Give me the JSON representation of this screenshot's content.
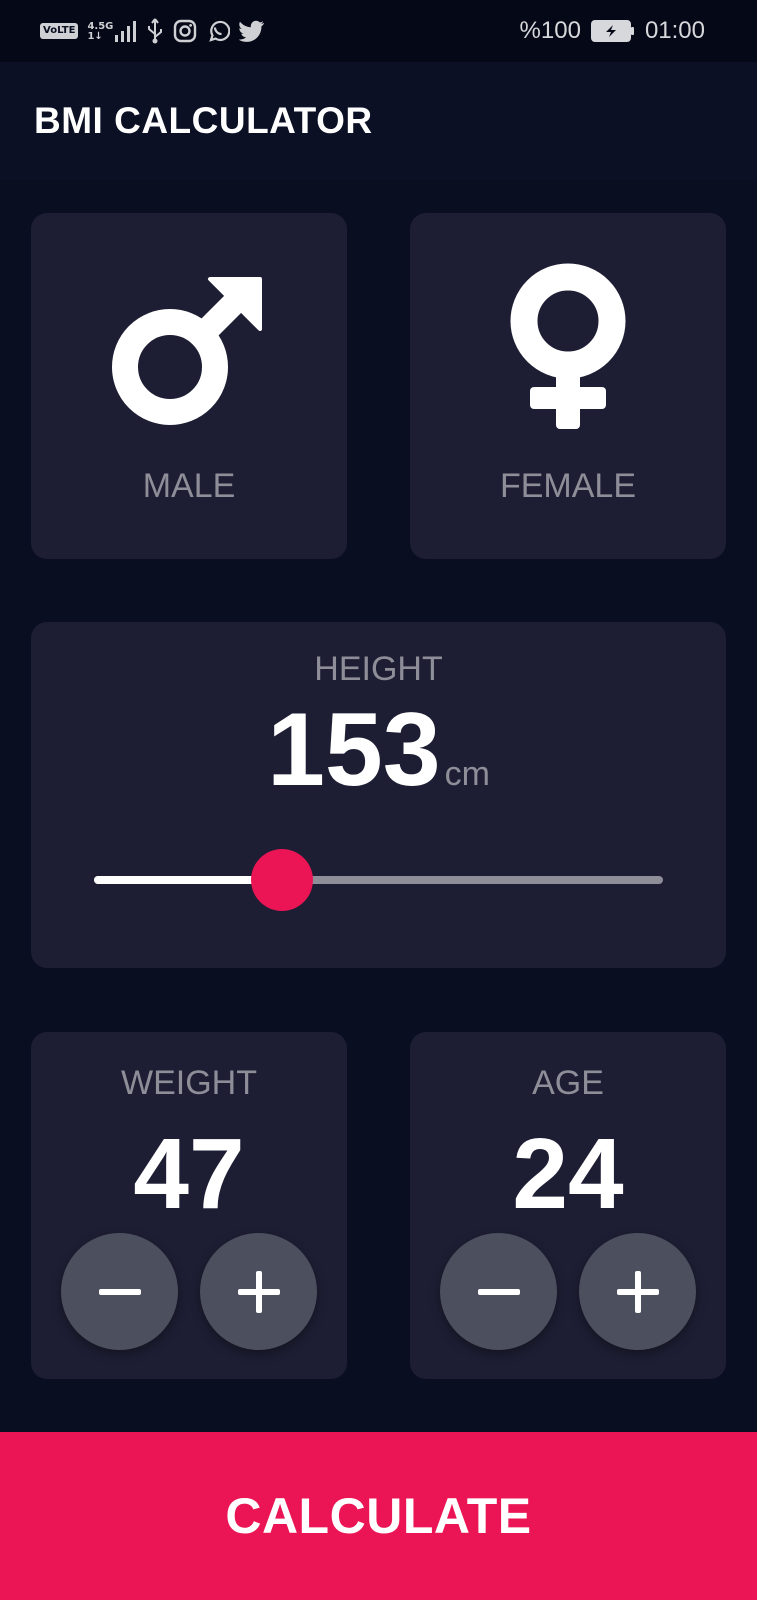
{
  "status_bar": {
    "volte": "VoLTE",
    "network": "4.5G",
    "network_sub": "1↓",
    "battery": "%100",
    "time": "01:00"
  },
  "app_bar": {
    "title": "BMI CALCULATOR"
  },
  "gender": {
    "male_label": "MALE",
    "female_label": "FEMALE"
  },
  "height": {
    "label": "HEIGHT",
    "value": "153",
    "unit": "cm",
    "slider_fraction": 0.33
  },
  "weight": {
    "label": "WEIGHT",
    "value": "47"
  },
  "age": {
    "label": "AGE",
    "value": "24"
  },
  "calculate": {
    "label": "CALCULATE"
  },
  "colors": {
    "background": "#0a0e21",
    "card": "#1d1e33",
    "accent": "#eb1555",
    "label": "#8d8e98",
    "button": "#4c4f5e"
  },
  "icons": {
    "male": "male-symbol-icon",
    "female": "female-symbol-icon",
    "minus": "minus-icon",
    "plus": "plus-icon"
  }
}
